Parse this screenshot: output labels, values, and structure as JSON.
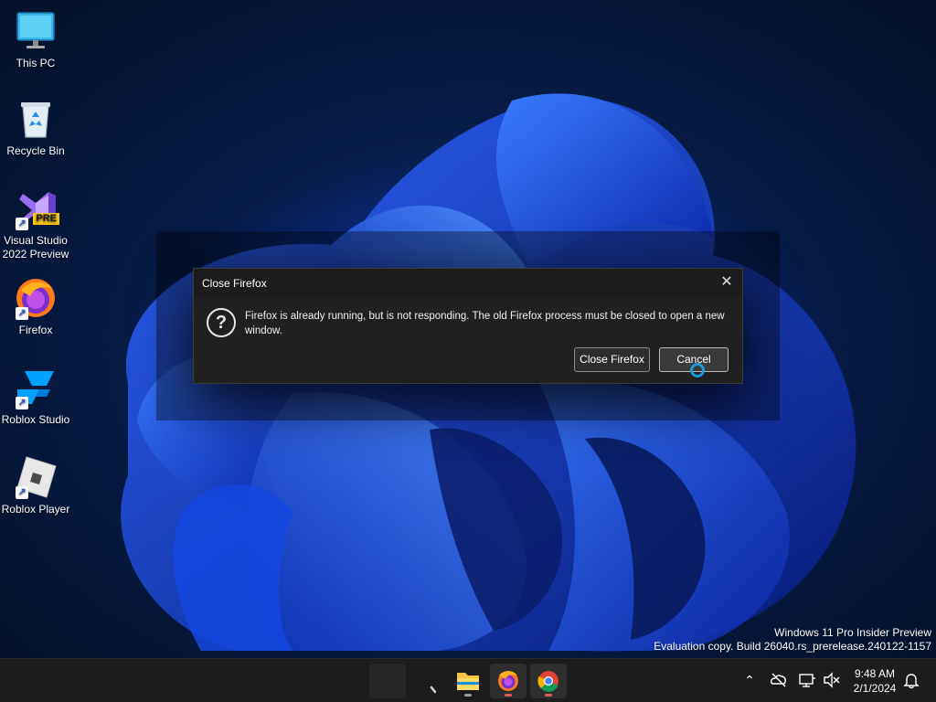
{
  "desktop": {
    "icons": [
      {
        "label": "This PC"
      },
      {
        "label": "Recycle Bin"
      },
      {
        "label": "Visual Studio 2022 Preview",
        "badge": "PRE"
      },
      {
        "label": "Firefox"
      },
      {
        "label": "Roblox Studio"
      },
      {
        "label": "Roblox Player"
      }
    ]
  },
  "dialog": {
    "title": "Close Firefox",
    "message": "Firefox is already running, but is not responding. The old Firefox process must be closed to open a new window.",
    "close_button_label": "Close Firefox",
    "cancel_button_label": "Cancel",
    "icon": "question-icon"
  },
  "watermark": {
    "line1": "Windows 11 Pro Insider Preview",
    "line2": "Evaluation copy. Build 26040.rs_prerelease.240122-1157"
  },
  "taskbar": {
    "items": [
      "start-icon",
      "search-icon",
      "file-explorer-icon",
      "firefox-icon",
      "chrome-icon"
    ],
    "tray": {
      "time": "9:48 AM",
      "date": "2/1/2024"
    }
  },
  "colors": {
    "accent": "#1c9ad6",
    "dialog_bg": "#202020",
    "taskbar_bg": "#1c1c1c"
  }
}
